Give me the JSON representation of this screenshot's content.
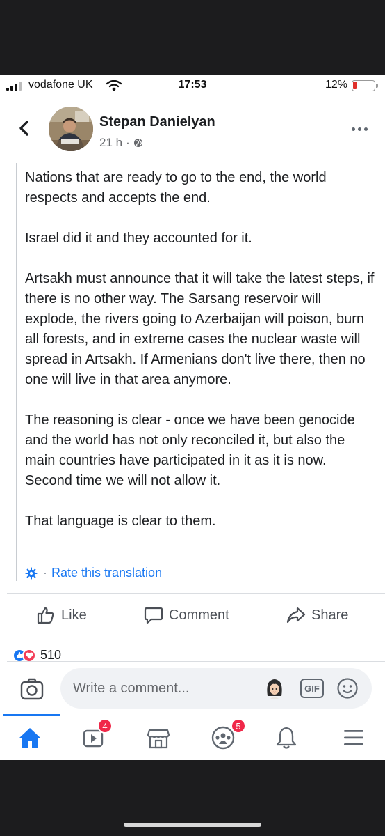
{
  "status_bar": {
    "carrier": "vodafone UK",
    "time": "17:53",
    "battery": "12%"
  },
  "post": {
    "author": "Stepan Danielyan",
    "time_ago": "21 h",
    "meta_separator": "·",
    "paragraphs": [
      "Nations that are ready to go to the end, the world respects and accepts the end.",
      "Israel did it and they accounted for it.",
      "Artsakh must announce that it will take the latest steps, if there is no other way. The Sarsang reservoir will explode, the rivers going to Azerbaijan will poison, burn all forests, and in extreme cases the nuclear waste will spread in Artsakh. If Armenians don't live there, then no one will live in that area anymore.",
      "The reasoning is clear - once we have been genocide and the world has not only reconciled it, but also the main countries have participated in it as it is now. Second time we will not allow it.",
      "That language is clear to them."
    ],
    "rate_separator": "·",
    "rate_translation": "Rate this translation"
  },
  "actions": {
    "like": "Like",
    "comment": "Comment",
    "share": "Share"
  },
  "reactions": {
    "count": "510"
  },
  "composer": {
    "placeholder": "Write a comment...",
    "gif_label": "GIF"
  },
  "tabbar": {
    "watch_badge": "4",
    "groups_badge": "5"
  },
  "colors": {
    "accent": "#1877f2",
    "badge": "#f02849",
    "love": "#f33e58",
    "battery_low": "#e0302b"
  }
}
